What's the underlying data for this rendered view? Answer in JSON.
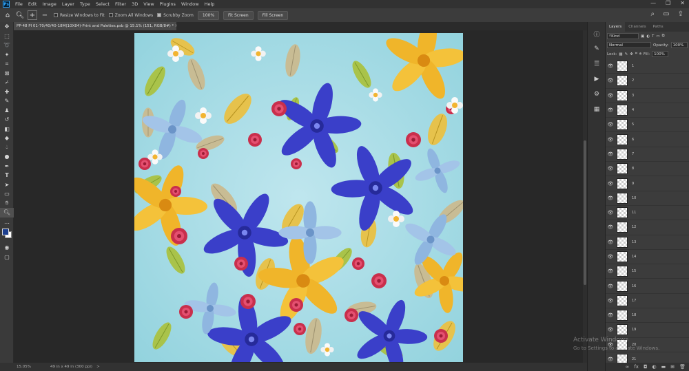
{
  "menu": [
    "File",
    "Edit",
    "Image",
    "Layer",
    "Type",
    "Select",
    "Filter",
    "3D",
    "View",
    "Plugins",
    "Window",
    "Help"
  ],
  "app_logo": "Ps",
  "window_controls": [
    "—",
    "❐",
    "✕"
  ],
  "options": {
    "resize_windows": "Resize Windows to Fit",
    "zoom_all": "Zoom All Windows",
    "scrubby_zoom": "Scrubby Zoom",
    "zoom_100": "100%",
    "fit_screen": "Fit Screen",
    "fill_screen": "Fill Screen"
  },
  "document_tab": "PP-48 PI 01-70/40/40-18M(10X84)-Print and Palettes.psb @ 15.1% (151, RGB/8#) * ✕",
  "status": {
    "zoom": "15.05%",
    "doc_info": "49 in x 49 in (300 ppi)",
    "arrow": ">"
  },
  "layers_panel": {
    "tabs": [
      "Layers",
      "Channels",
      "Paths"
    ],
    "filter_kind": "Kind",
    "blend_mode": "Normal",
    "opacity_label": "Opacity:",
    "opacity_value": "100%",
    "lock_label": "Lock:",
    "fill_label": "Fill:",
    "fill_value": "100%",
    "layers": [
      "1",
      "2",
      "3",
      "4",
      "5",
      "6",
      "7",
      "8",
      "9",
      "10",
      "11",
      "12",
      "13",
      "14",
      "15",
      "16",
      "17",
      "18",
      "19",
      "20",
      "21"
    ]
  },
  "watermark": {
    "title": "Activate Windows",
    "subtitle": "Go to Settings to activate Windows."
  },
  "colors": {
    "foreground": "#1d3f8f",
    "background": "#ffffff",
    "pattern_bg": "#a9dde6"
  }
}
